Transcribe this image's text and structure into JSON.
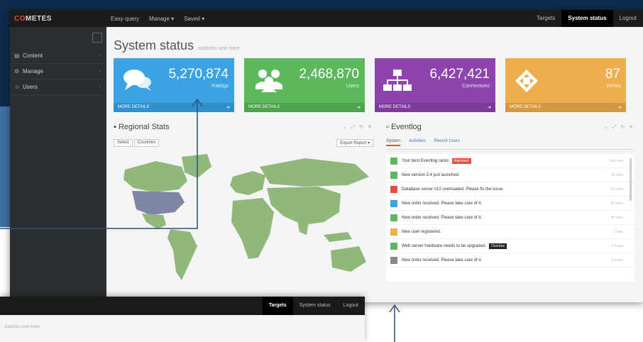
{
  "brand": {
    "prefix": "CO",
    "rest": "METES"
  },
  "topnav": [
    "Easy query",
    "Manage ▾",
    "Saved ▾"
  ],
  "topright": {
    "targets": "Targets",
    "system_status": "System status",
    "logout": "Logout"
  },
  "sidebar": [
    {
      "label": "Content",
      "icon": "▤"
    },
    {
      "label": "Manage",
      "icon": "⚙"
    },
    {
      "label": "Users",
      "icon": "☺"
    }
  ],
  "page": {
    "title": "System status",
    "subtitle": "statistics and more"
  },
  "tiles": [
    {
      "value": "5,270,874",
      "label": "Ratings",
      "foot": "MORE DETAILS",
      "color": "#3aa3e3"
    },
    {
      "value": "2,468,870",
      "label": "Users",
      "foot": "MORE DETAILS",
      "color": "#5cb85c"
    },
    {
      "value": "6,427,421",
      "label": "Connections",
      "foot": "MORE DETAILS",
      "color": "#8e44ad"
    },
    {
      "value": "87",
      "label": "Errors",
      "foot": "MORE DETAILS",
      "color": "#f0ad4e"
    }
  ],
  "regional": {
    "title": "Regional Stats",
    "btn_left_1": "Select",
    "btn_left_2": "Countries",
    "btn_right": "Export Report ▾"
  },
  "eventlog": {
    "title": "Eventlog",
    "tabs": [
      "System",
      "Activities",
      "Recent Users"
    ],
    "events": [
      {
        "text": "Your best Eventlog ranks",
        "badge": "Important",
        "badge_color": "#e74c3c",
        "color": "#5cb85c",
        "time": "Just now"
      },
      {
        "text": "New version 2.4 just launched",
        "badge": "",
        "badge_color": "",
        "color": "#5cb85c",
        "time": "16 mins"
      },
      {
        "text": "Database server #12 overloaded. Please fix the issue.",
        "badge": "",
        "badge_color": "",
        "color": "#e74c3c",
        "time": "24 mins"
      },
      {
        "text": "New order received. Please take care of it.",
        "badge": "",
        "badge_color": "",
        "color": "#3aa3e3",
        "time": "30 mins"
      },
      {
        "text": "New order received. Please take care of it.",
        "badge": "",
        "badge_color": "",
        "color": "#5cb85c",
        "time": "40 mins"
      },
      {
        "text": "New user registered.",
        "badge": "",
        "badge_color": "",
        "color": "#f0ad4e",
        "time": "1 hour"
      },
      {
        "text": "Web server hardware needs to be upgraded.",
        "badge": "Overdue",
        "badge_color": "#222",
        "color": "#5cb85c",
        "time": "2 hours"
      },
      {
        "text": "New order received. Please take care of it.",
        "badge": "",
        "badge_color": "",
        "color": "#888",
        "time": "3 hours"
      }
    ]
  },
  "window2": {
    "targets": "Targets",
    "system_status": "System status",
    "logout": "Logout",
    "subtitle": "statistics and more"
  }
}
